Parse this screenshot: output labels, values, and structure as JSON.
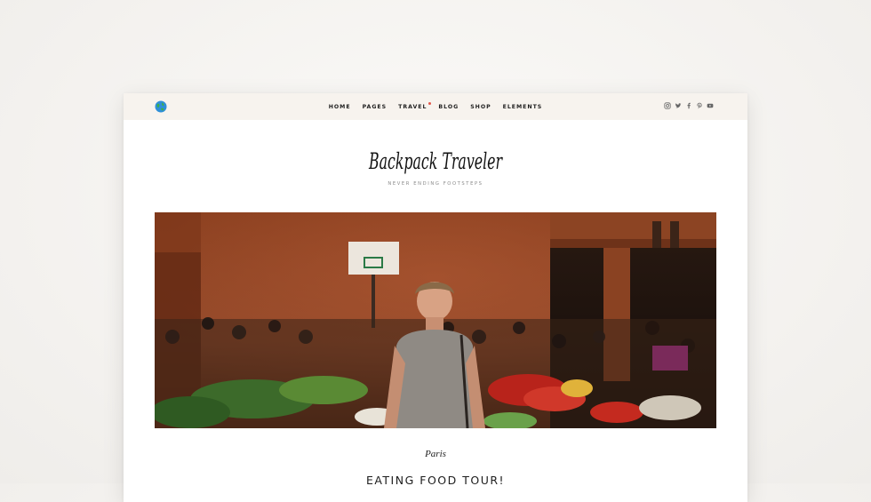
{
  "header": {
    "nav": [
      "HOME",
      "PAGES",
      "TRAVEL",
      "BLOG",
      "SHOP",
      "ELEMENTS"
    ],
    "nav_active_marker_on": "TRAVEL",
    "social_icons": [
      "instagram-icon",
      "twitter-icon",
      "facebook-icon",
      "pinterest-icon",
      "youtube-icon"
    ],
    "logo_icon": "globe-icon"
  },
  "brand": {
    "title": "Backpack Traveler",
    "tagline": "Never Ending Footsteps"
  },
  "post": {
    "category": "Paris",
    "title": "Eating Food Tour!"
  },
  "colors": {
    "topbar_bg": "#f7f3ee",
    "accent_dot": "#e2574c",
    "text_dark": "#1e1e1e"
  }
}
